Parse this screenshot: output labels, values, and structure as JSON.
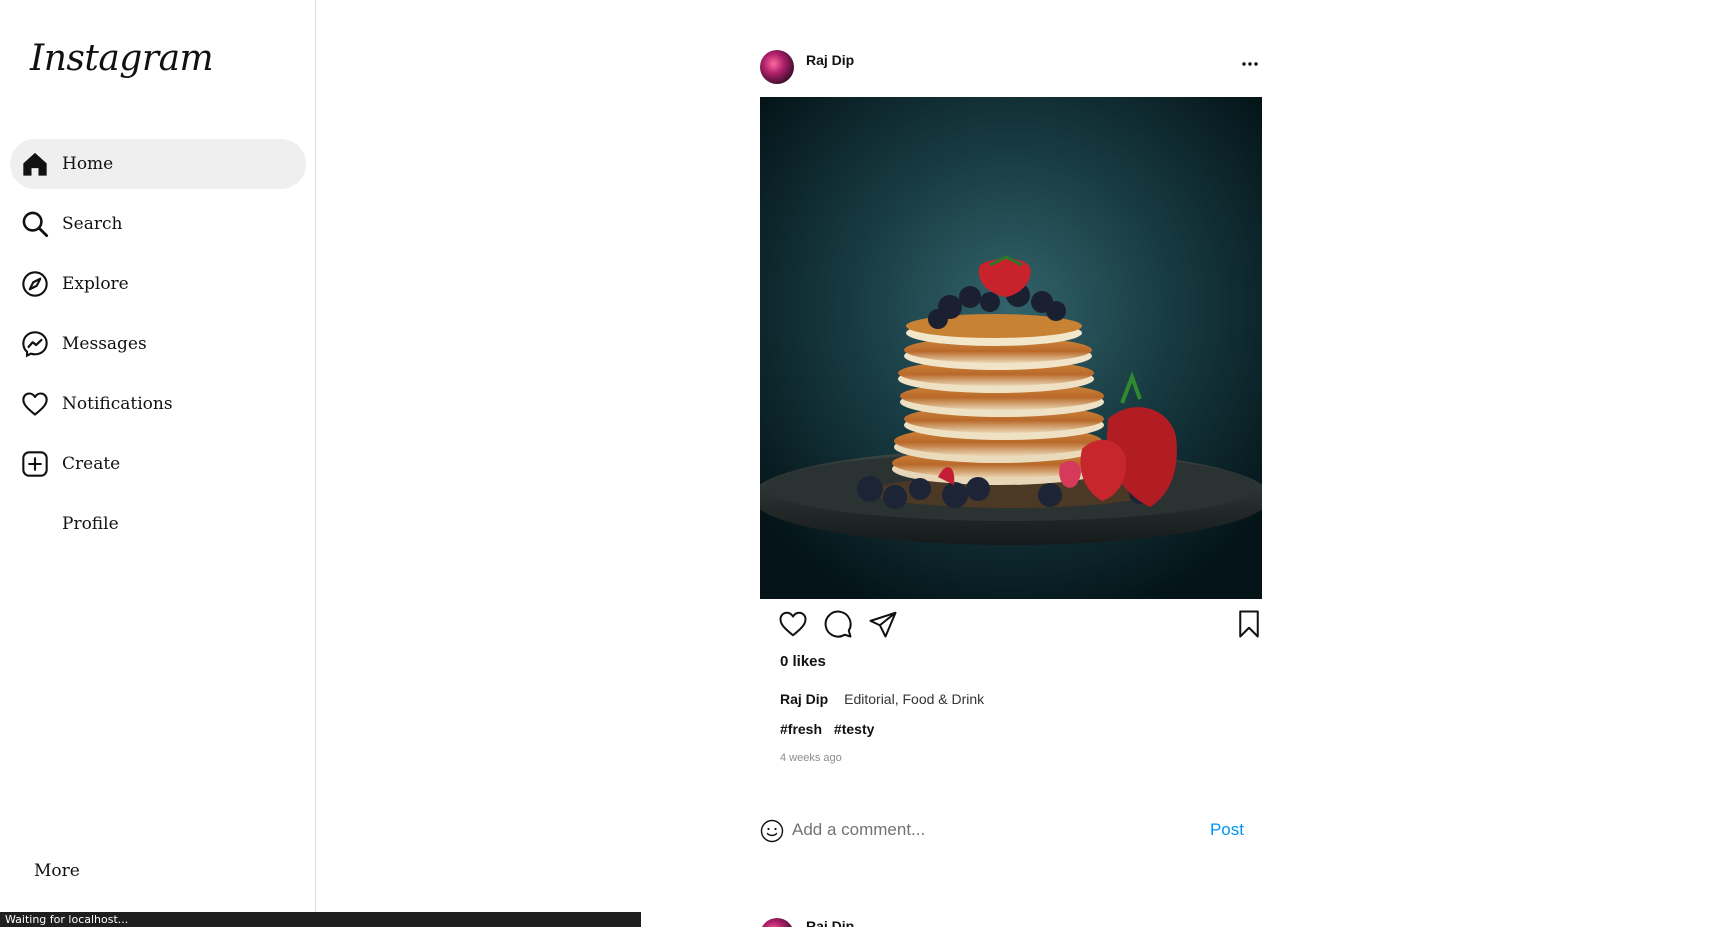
{
  "app": {
    "logo_text": "Instagram"
  },
  "sidebar": {
    "items": [
      {
        "label": "Home",
        "icon": "home-icon",
        "active": true
      },
      {
        "label": "Search",
        "icon": "search-icon"
      },
      {
        "label": "Explore",
        "icon": "compass-icon"
      },
      {
        "label": "Messages",
        "icon": "messenger-icon"
      },
      {
        "label": "Notifications",
        "icon": "heart-icon"
      },
      {
        "label": "Create",
        "icon": "plus-square-icon"
      },
      {
        "label": "Profile",
        "icon": ""
      }
    ],
    "more_label": "More"
  },
  "post": {
    "author": "Raj Dip",
    "menu_icon": "more-dots-icon",
    "likes": "0 likes",
    "caption_user": "Raj Dip",
    "caption_text": "Editorial, Food & Drink",
    "tags": [
      "#fresh",
      "#testy"
    ],
    "time": "4 weeks ago",
    "comment_placeholder": "Add a comment...",
    "post_button": "Post"
  },
  "next_post": {
    "author": "Raj Dip"
  },
  "status_bar": {
    "text": "Waiting for localhost..."
  },
  "colors": {
    "accent": "#0095f6",
    "active_bg": "#efefef"
  }
}
